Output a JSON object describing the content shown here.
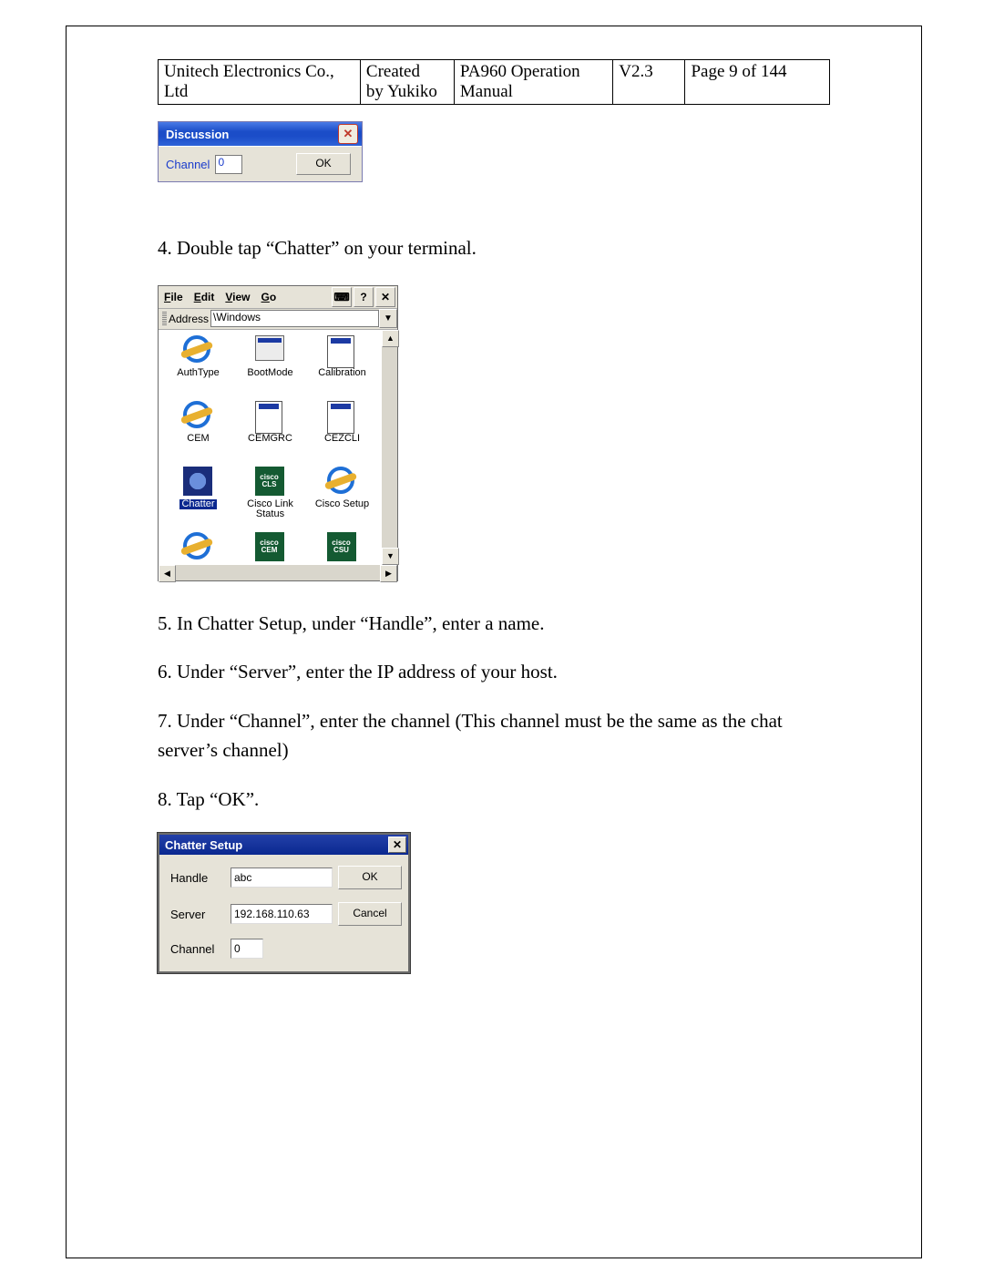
{
  "header": {
    "company": "Unitech Electronics Co., Ltd",
    "created_label": "Created",
    "created_by": "by Yukiko",
    "manual_title": "PA960 Operation",
    "manual_sub": "Manual",
    "version": "V2.3",
    "page": "Page 9 of 144"
  },
  "discussion": {
    "title": "Discussion",
    "channel_label": "Channel",
    "channel_value": "0",
    "ok_label": "OK"
  },
  "step4": "4. Double tap “Chatter” on your terminal.",
  "explorer": {
    "menu_file_u": "F",
    "menu_file_rest": "ile",
    "menu_edit_u": "E",
    "menu_edit_rest": "dit",
    "menu_view_u": "V",
    "menu_view_rest": "iew",
    "menu_go_u": "G",
    "menu_go_rest": "o",
    "kb_icon": "⌨",
    "help_icon": "?",
    "close_icon": "✕",
    "address_label": "Address",
    "address_value": "\\Windows",
    "drop_icon": "▼",
    "up_icon": "▲",
    "down_icon": "▼",
    "left_icon": "◀",
    "right_icon": "▶",
    "icons": [
      {
        "label": "AuthType"
      },
      {
        "label": "BootMode"
      },
      {
        "label": "Calibration"
      },
      {
        "label": "CEM"
      },
      {
        "label": "CEMGRC"
      },
      {
        "label": "CEZCLI"
      },
      {
        "label": "Chatter"
      },
      {
        "label": "Cisco Link Status"
      },
      {
        "label": "Cisco Setup"
      },
      {
        "label": ""
      },
      {
        "label": ""
      },
      {
        "label": ""
      }
    ],
    "cisco_top": "cisco",
    "cisco_cls": "CLS",
    "cisco_cem": "CEM",
    "cisco_csu": "CSU"
  },
  "step5": "5. In Chatter Setup, under “Handle”, enter a name.",
  "step6": "6. Under “Server”, enter the IP address of your host.",
  "step7": "7. Under “Channel”, enter the channel (This channel must be the same as the chat server’s channel)",
  "step8": "8. Tap “OK”.",
  "chatter_setup": {
    "title": "Chatter Setup",
    "handle_label": "Handle",
    "handle_value": "abc",
    "server_label": "Server",
    "server_value": "192.168.110.63",
    "channel_label": "Channel",
    "channel_value": "0",
    "ok_label": "OK",
    "cancel_label": "Cancel",
    "close_icon": "✕"
  }
}
